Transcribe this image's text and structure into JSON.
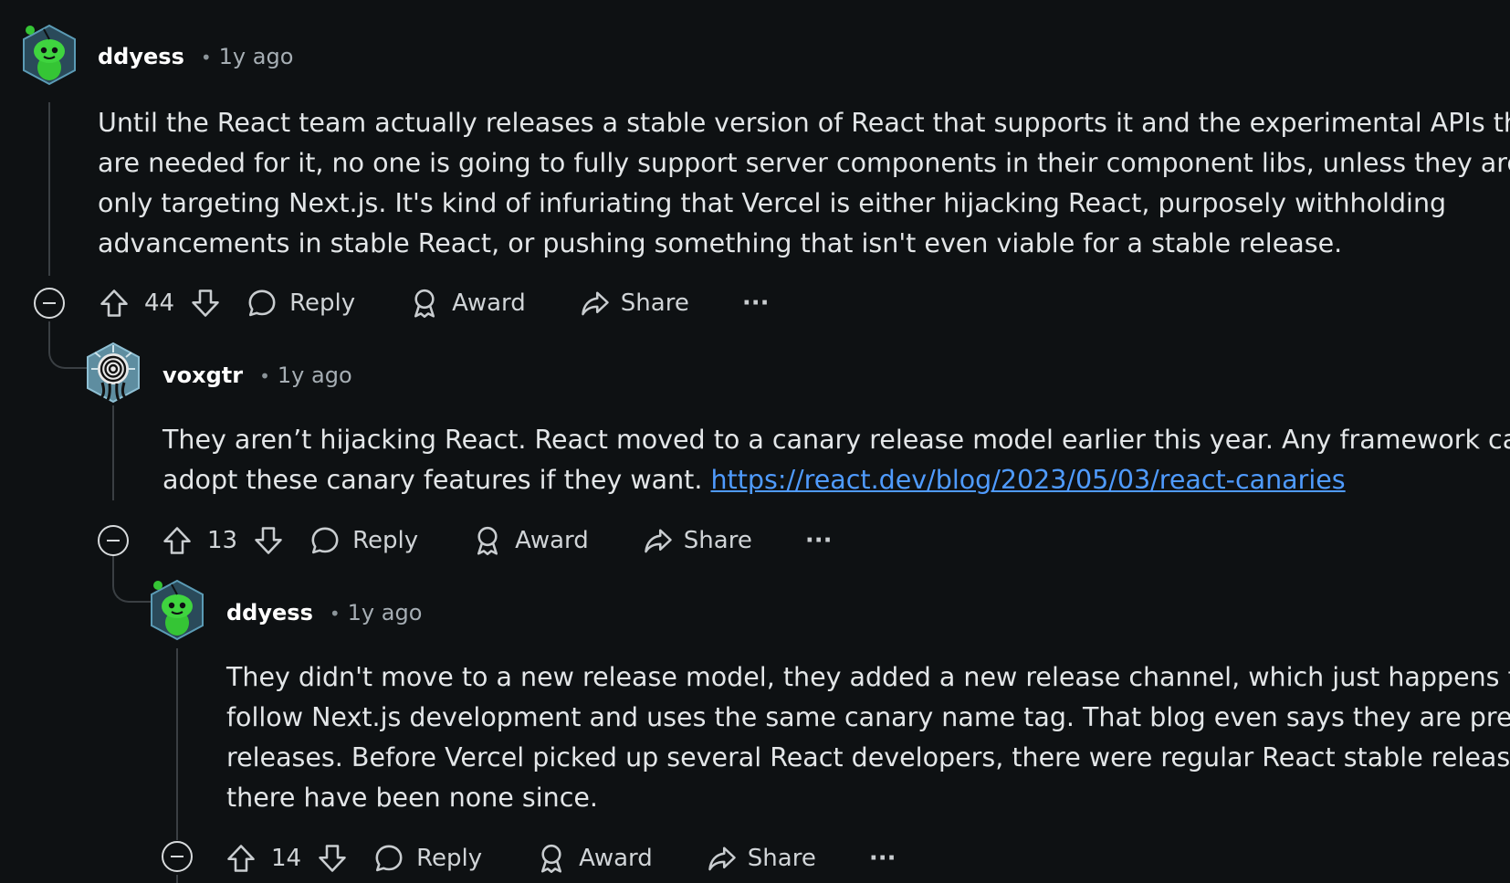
{
  "colors": {
    "background": "#0e1113",
    "link": "#4f9bff",
    "avatar_green": "#35c535",
    "thread_line": "#3a3f43"
  },
  "comments": [
    {
      "author": "ddyess",
      "separator": "•",
      "time": "1y ago",
      "avatar_icon": "snoo-green-avatar",
      "body_lines": [
        "Until the React team actually releases a stable version of React that supports it and the experimental APIs that",
        "are needed for it, no one is going to fully support server components in their component libs, unless they are",
        "only targeting Next.js. It's kind of infuriating that Vercel is either hijacking React, purposely withholding",
        "advancements in stable React, or pushing something that isn't even viable for a stable release."
      ],
      "votes": "44",
      "actions": {
        "reply": "Reply",
        "award": "Award",
        "share": "Share",
        "more": "···"
      }
    },
    {
      "author": "voxgtr",
      "separator": "•",
      "time": "1y ago",
      "avatar_icon": "spiral-avatar",
      "body_lines": [
        "They aren’t hijacking React. React moved to a canary release model earlier this year. Any framework can",
        "adopt these canary features if they want. "
      ],
      "link": "https://react.dev/blog/2023/05/03/react-canaries",
      "votes": "13",
      "actions": {
        "reply": "Reply",
        "award": "Award",
        "share": "Share",
        "more": "···"
      }
    },
    {
      "author": "ddyess",
      "separator": "•",
      "time": "1y ago",
      "avatar_icon": "snoo-green-avatar",
      "body_lines": [
        "They didn't move to a new release model, they added a new release channel, which just happens to",
        "follow Next.js development and uses the same canary name tag. That blog even says they are pre-",
        "releases. Before Vercel picked up several React developers, there were regular React stable releases,",
        "there have been none since."
      ],
      "votes": "14",
      "actions": {
        "reply": "Reply",
        "award": "Award",
        "share": "Share",
        "more": "···"
      }
    }
  ]
}
